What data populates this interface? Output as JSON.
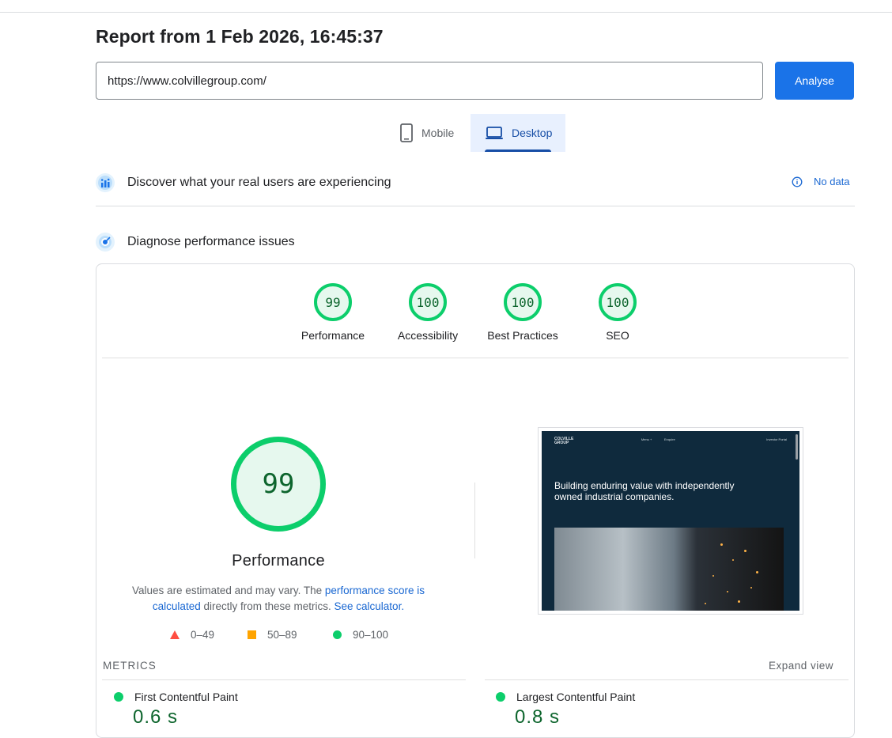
{
  "report": {
    "title": "Report from 1 Feb 2026, 16:45:37"
  },
  "search": {
    "url": "https://www.colvillegroup.com/",
    "analyse_label": "Analyse"
  },
  "tabs": {
    "mobile": "Mobile",
    "desktop": "Desktop",
    "selected": "Desktop"
  },
  "real_users": {
    "title": "Discover what your real users are experiencing",
    "status": "No data"
  },
  "diagnose": {
    "title": "Diagnose performance issues"
  },
  "categories": [
    {
      "score": "99",
      "label": "Performance"
    },
    {
      "score": "100",
      "label": "Accessibility"
    },
    {
      "score": "100",
      "label": "Best Practices"
    },
    {
      "score": "100",
      "label": "SEO"
    }
  ],
  "performance": {
    "score": "99",
    "title": "Performance",
    "desc_1": "Values are estimated and may vary. The ",
    "link_score": "performance score is calculated",
    "desc_2": " directly from these metrics. ",
    "link_calc": "See calculator.",
    "legend": {
      "fail": "0–49",
      "average": "50–89",
      "pass": "90–100"
    },
    "status_colors": {
      "fail": "#ff4e42",
      "average": "#ffa400",
      "pass": "#0cce6b"
    }
  },
  "screenshot": {
    "brand": "COLVILLE\nGROUP",
    "nav_1": "Menu +",
    "nav_2": "Enquire",
    "nav_3": "Investor Portal",
    "headline": "Building enduring value with independently owned industrial companies."
  },
  "metrics": {
    "header": "METRICS",
    "expand": "Expand view",
    "items": [
      {
        "name": "First Contentful Paint",
        "value": "0.6 s"
      },
      {
        "name": "Largest Contentful Paint",
        "value": "0.8 s"
      }
    ]
  }
}
